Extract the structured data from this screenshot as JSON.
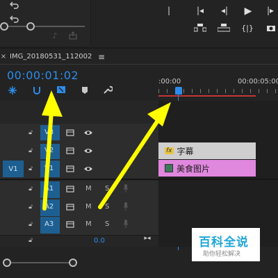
{
  "source_monitor": {
    "transport_buttons": [
      "step-back-icon",
      "play-icon",
      "go-to-in-icon",
      "marker-icon"
    ]
  },
  "sequence_tab": {
    "title": "IMG_20180531_112002",
    "menu_icon": "≡"
  },
  "timecode": "00:00:01:02",
  "ruler": {
    "start": ":00:00",
    "end": "00:00:05:00"
  },
  "tracks": {
    "video": [
      {
        "name": "V3"
      },
      {
        "name": "V2"
      },
      {
        "name": "V1",
        "source_patch": "V1"
      }
    ],
    "audio": [
      {
        "name": "A1",
        "m": "M",
        "s": "S"
      },
      {
        "name": "A2",
        "m": "M",
        "s": "S"
      },
      {
        "name": "A3",
        "m": "M",
        "s": "S"
      }
    ],
    "master_value": "0.0"
  },
  "clips": [
    {
      "label": "字幕",
      "color": "#cfcfcf",
      "icon": "fx"
    },
    {
      "label": "美食图片",
      "color": "#e087de",
      "icon": "image"
    }
  ],
  "watermark": {
    "title": "百科全说",
    "subtitle": "助你轻松解决"
  },
  "colors": {
    "timecode_blue": "#2d8ceb",
    "playhead_blue": "#2d8ceb",
    "annotation_arrow": "#ffff00",
    "work_area_red": "#c23636"
  }
}
